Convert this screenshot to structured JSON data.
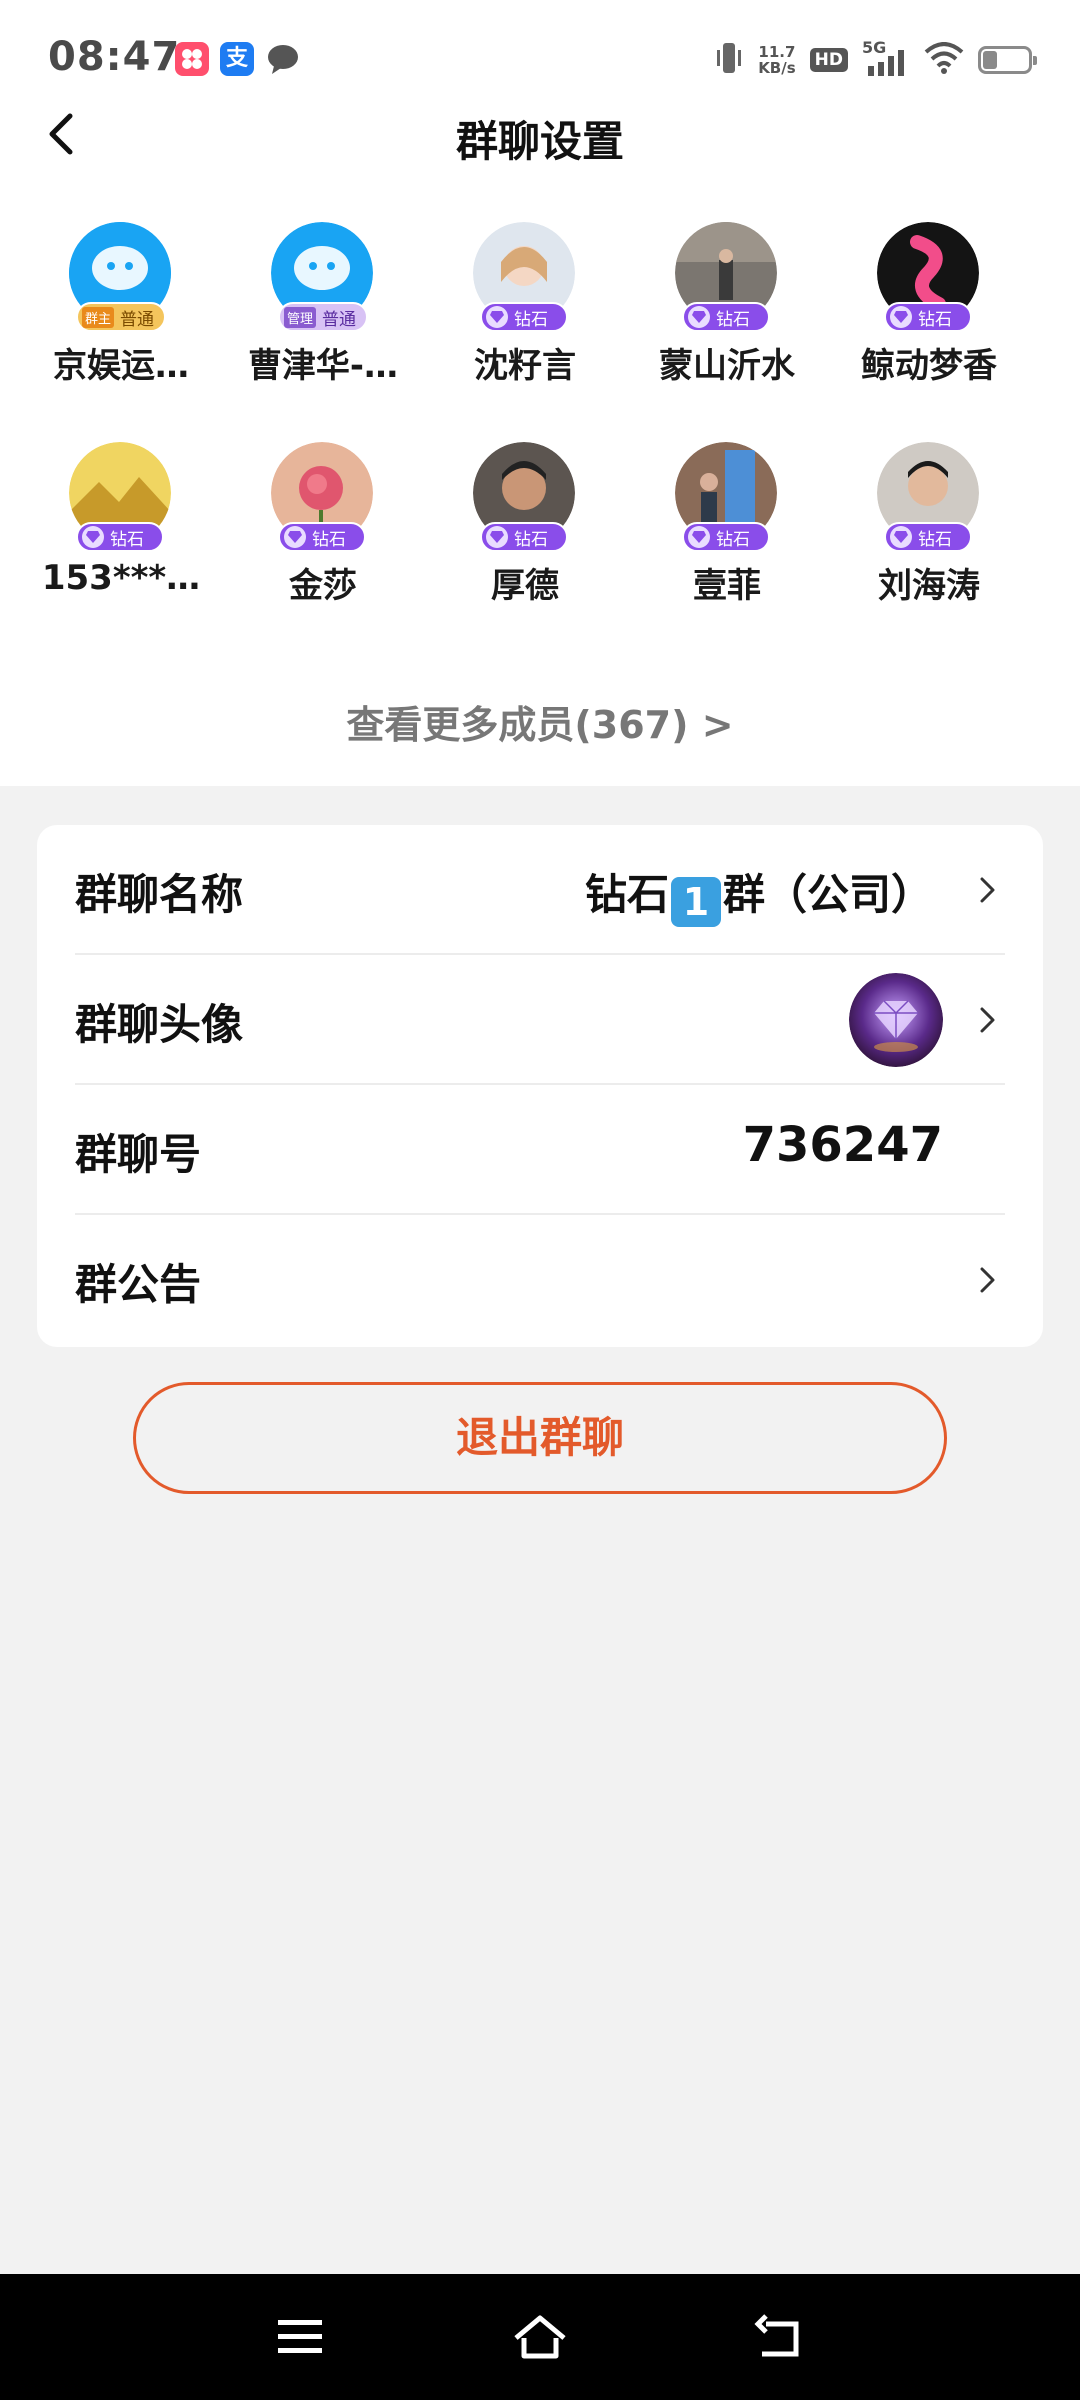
{
  "status_bar": {
    "time": "08:47",
    "net_speed_value": "11.7",
    "net_speed_unit": "KB/s",
    "hd": "HD",
    "network": "5G",
    "icons": [
      "taobao-app-icon",
      "alipay-app-icon",
      "message-bubble-icon",
      "vibrate-icon",
      "signal-icon",
      "wifi-icon",
      "battery-icon"
    ]
  },
  "header": {
    "title": "群聊设置",
    "back_icon": "chevron-left-icon"
  },
  "members": [
    {
      "name": "京娱运…",
      "badge": "普通",
      "role": "群主",
      "avatar_color": "#1ea7f5"
    },
    {
      "name": "曹津华-…",
      "badge": "普通",
      "role": "管理",
      "avatar_color": "#1ea7f5"
    },
    {
      "name": "沈籽言",
      "badge": "钻石",
      "avatar_color": "#dfe6ee"
    },
    {
      "name": "蒙山沂水",
      "badge": "钻石",
      "avatar_color": "#6d6a66"
    },
    {
      "name": "鲸动梦香",
      "badge": "钻石",
      "avatar_color": "#1b1b1b"
    },
    {
      "name": "153***…",
      "badge": "钻石",
      "avatar_color": "#e8c23a"
    },
    {
      "name": "金莎",
      "badge": "钻石",
      "avatar_color": "#d79a8a"
    },
    {
      "name": "厚德",
      "badge": "钻石",
      "avatar_color": "#8b6a55"
    },
    {
      "name": "壹菲",
      "badge": "钻石",
      "avatar_color": "#5a7fa5"
    },
    {
      "name": "刘海涛",
      "badge": "钻石",
      "avatar_color": "#c9c6c2"
    }
  ],
  "more_members": "查看更多成员(367)  >",
  "settings": {
    "name_label": "群聊名称",
    "name_value_a": "钻石",
    "name_value_num": "1",
    "name_value_b": "群（公司）",
    "avatar_label": "群聊头像",
    "number_label": "群聊号",
    "number_value": "736247",
    "notice_label": "群公告"
  },
  "exit_button": "退出群聊",
  "nav": {
    "icons": [
      "menu-icon",
      "home-icon",
      "back-icon"
    ]
  },
  "colors": {
    "accent": "#e35a2b",
    "diamond_badge": "#8a4dea",
    "normal_badge": "#f4c55c",
    "page_bg": "#f2f2f2"
  }
}
